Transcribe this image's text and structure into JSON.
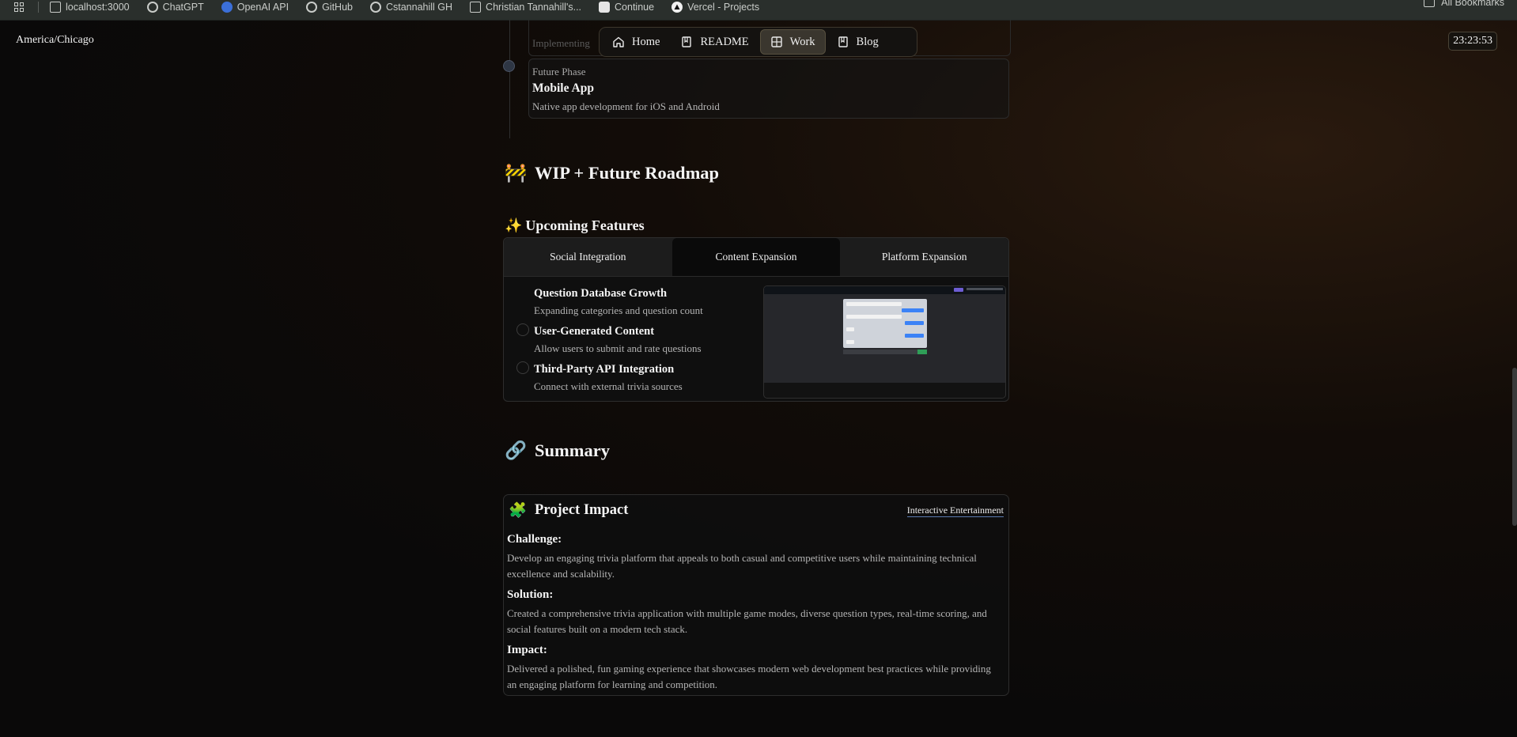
{
  "bookmarks": {
    "items": [
      {
        "label": "localhost:3000",
        "icon": "page-icon"
      },
      {
        "label": "ChatGPT",
        "icon": "openai-icon"
      },
      {
        "label": "OpenAI API",
        "icon": "openai-api-icon"
      },
      {
        "label": "GitHub",
        "icon": "github-icon"
      },
      {
        "label": "Cstannahill GH",
        "icon": "github-icon"
      },
      {
        "label": "Christian Tannahill's...",
        "icon": "page-icon"
      },
      {
        "label": "Continue",
        "icon": "continue-icon"
      },
      {
        "label": "Vercel - Projects",
        "icon": "vercel-icon"
      }
    ],
    "all_label": "All Bookmarks"
  },
  "header": {
    "timezone": "America/Chicago",
    "clock": "23:23:53"
  },
  "nav": {
    "items": [
      {
        "label": "Home",
        "icon": "home-icon"
      },
      {
        "label": "README",
        "icon": "book-icon"
      },
      {
        "label": "Work",
        "icon": "grid-icon",
        "active": true
      },
      {
        "label": "Blog",
        "icon": "book-icon"
      }
    ]
  },
  "timeline": {
    "prev_text": "Implementing",
    "phase": "Future Phase",
    "title": "Mobile App",
    "description": "Native app development for iOS and Android"
  },
  "roadmap": {
    "heading_emoji": "🚧",
    "heading": "WIP + Future Roadmap",
    "sub_emoji": "✨",
    "subheading": "Upcoming Features",
    "tabs": [
      "Social Integration",
      "Content Expansion",
      "Platform Expansion"
    ],
    "active_tab": "Content Expansion",
    "features": [
      {
        "title": "Question Database Growth",
        "description": "Expanding categories and question count"
      },
      {
        "title": "User-Generated Content",
        "description": "Allow users to submit and rate questions"
      },
      {
        "title": "Third-Party API Integration",
        "description": "Connect with external trivia sources"
      }
    ]
  },
  "summary": {
    "heading_emoji": "🔗",
    "heading": "Summary",
    "card_emoji": "🧩",
    "card_title": "Project Impact",
    "badge": "Interactive Entertainment",
    "challenge_label": "Challenge:",
    "challenge_text": "Develop an engaging trivia platform that appeals to both casual and competitive users while maintaining technical excellence and scalability.",
    "solution_label": "Solution:",
    "solution_text": "Created a comprehensive trivia application with multiple game modes, diverse question types, real-time scoring, and social features built on a modern tech stack.",
    "impact_label": "Impact:",
    "impact_text": "Delivered a polished, fun gaming experience that showcases modern web development best practices while providing an engaging platform for learning and competition."
  },
  "colors": {
    "accent_badge_underline": "#5a7ab0",
    "preview_chat_bg": "#cfd3da",
    "preview_bubble": "#3b82f6"
  }
}
